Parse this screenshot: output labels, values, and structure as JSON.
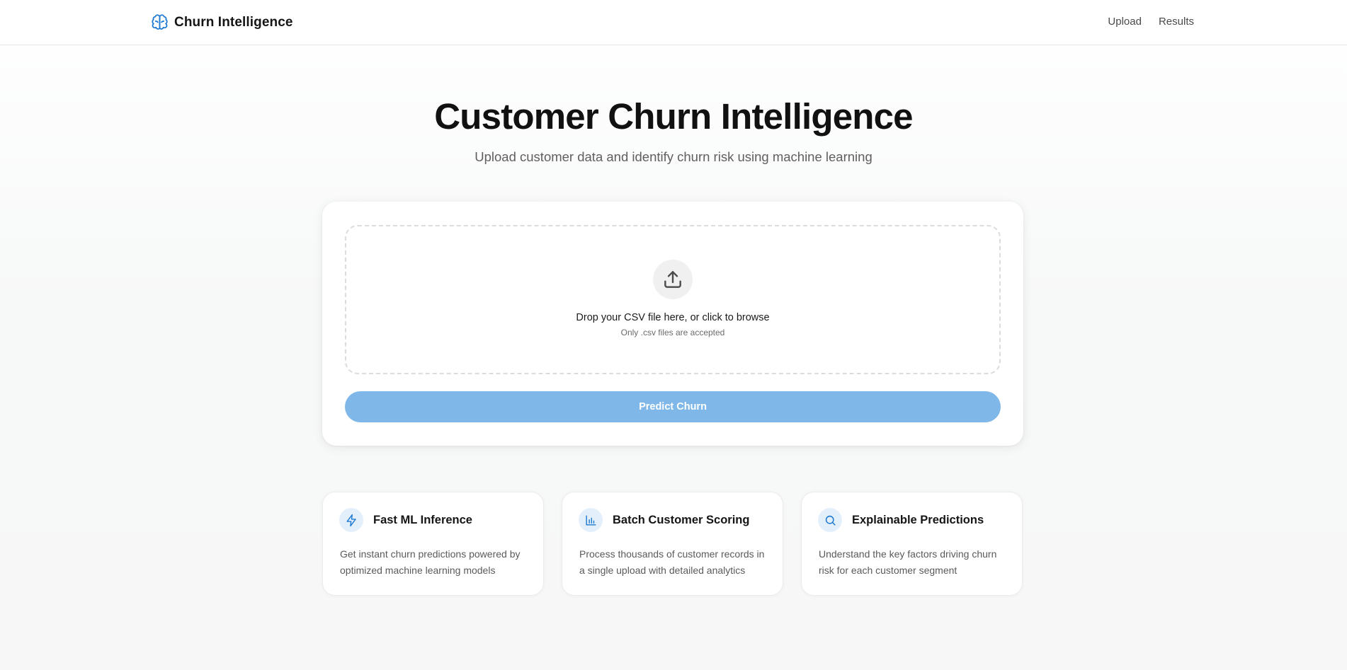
{
  "header": {
    "brand_name": "Churn Intelligence",
    "brand_icon": "brain-icon",
    "nav": [
      {
        "label": "Upload"
      },
      {
        "label": "Results"
      }
    ]
  },
  "hero": {
    "title": "Customer Churn Intelligence",
    "subtitle": "Upload customer data and identify churn risk using machine learning"
  },
  "upload": {
    "icon": "upload-icon",
    "drop_title": "Drop your CSV file here, or click to browse",
    "drop_hint": "Only .csv files are accepted",
    "button_label": "Predict Churn"
  },
  "features": [
    {
      "icon": "lightning-icon",
      "title": "Fast ML Inference",
      "description": "Get instant churn predictions powered by optimized machine learning models"
    },
    {
      "icon": "bar-chart-icon",
      "title": "Batch Customer Scoring",
      "description": "Process thousands of customer records in a single upload with detailed analytics"
    },
    {
      "icon": "search-icon",
      "title": "Explainable Predictions",
      "description": "Understand the key factors driving churn risk for each customer segment"
    }
  ],
  "colors": {
    "accent": "#1f7ad1",
    "button_disabled": "#7fb8e8",
    "icon_badge_bg": "#e3f0fb"
  }
}
